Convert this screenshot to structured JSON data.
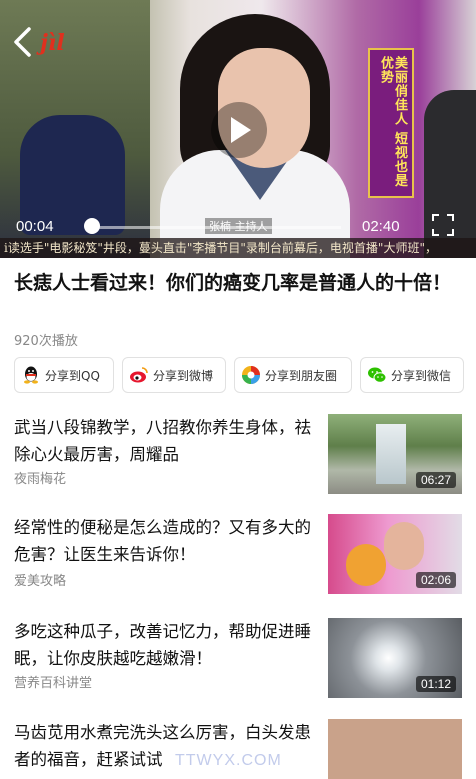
{
  "player": {
    "back_label": "<",
    "channel_logo": "jìl",
    "current_time": "00:04",
    "total_time": "02:40",
    "progress": 0.025,
    "banner_text": "美丽俏佳人 短视也是优势",
    "caption": "张楠 主持人",
    "ticker": "i读选手\"电影秘笈\"井段，蔓头直击\"李播节目\"录制台前幕后，电视首播\"大师班\"，"
  },
  "video": {
    "title": "长痣人士看过来！你们的癌变几率是普通人的十倍！",
    "play_count": "920次播放"
  },
  "share": {
    "qq": "分享到QQ",
    "weibo": "分享到微博",
    "moments": "分享到朋友圈",
    "wechat": "分享到微信"
  },
  "recommendations": [
    {
      "title": "武当八段锦教学，八招教你养生身体，祛除心火最厉害，周耀品",
      "source": "夜雨梅花",
      "duration": "06:27"
    },
    {
      "title": "经常性的便秘是怎么造成的？又有多大的危害？让医生来告诉你！",
      "source": "爱美攻略",
      "duration": "02:06"
    },
    {
      "title": "多吃这种瓜子，改善记忆力，帮助促进睡眠，让你皮肤越吃越嫩滑！",
      "source": "营养百科讲堂",
      "duration": "01:12"
    },
    {
      "title": "马齿苋用水煮完洗头这么厉害，白头发患者的福音，赶紧试试",
      "source": "",
      "duration": ""
    }
  ],
  "watermark": "TTWYX.COM",
  "colors": {
    "accent_red": "#e0301e",
    "text_primary": "#111111",
    "text_secondary": "#888888"
  }
}
